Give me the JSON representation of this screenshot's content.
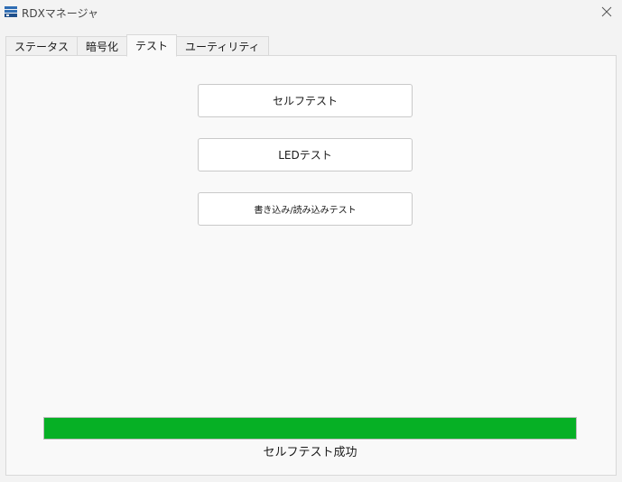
{
  "window": {
    "title": "RDXマネージャ",
    "icon": "rdx-app-icon",
    "close_icon": "close-icon"
  },
  "tabs": [
    {
      "label": "ステータス",
      "active": false
    },
    {
      "label": "暗号化",
      "active": false
    },
    {
      "label": "テスト",
      "active": true
    },
    {
      "label": "ユーティリティ",
      "active": false
    }
  ],
  "test_panel": {
    "self_test_label": "セルフテスト",
    "led_test_label": "LEDテスト",
    "rw_test_label": "書き込み/読み込みテスト",
    "progress_percent": 100,
    "progress_color": "#06b025",
    "status_text": "セルフテスト成功"
  }
}
